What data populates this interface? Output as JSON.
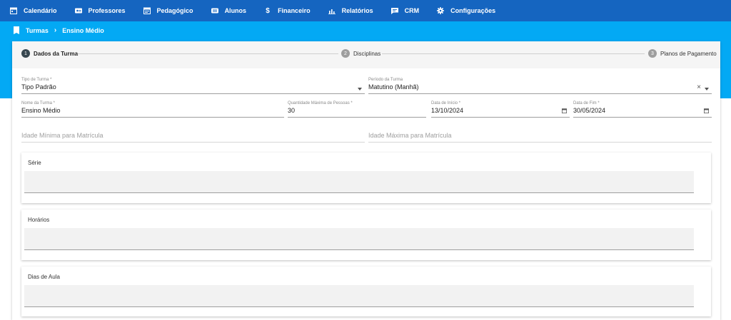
{
  "nav": {
    "items": [
      {
        "label": "Calendário",
        "icon": "calendar-icon"
      },
      {
        "label": "Professores",
        "icon": "id-card-icon"
      },
      {
        "label": "Pedagógico",
        "icon": "calendar-note-icon"
      },
      {
        "label": "Alunos",
        "icon": "students-icon"
      },
      {
        "label": "Financeiro",
        "icon": "dollar-icon"
      },
      {
        "label": "Relatórios",
        "icon": "chart-icon"
      },
      {
        "label": "CRM",
        "icon": "chat-icon"
      },
      {
        "label": "Configurações",
        "icon": "gear-icon"
      }
    ]
  },
  "breadcrumb": {
    "root": "Turmas",
    "current": "Ensino Médio"
  },
  "stepper": {
    "steps": [
      {
        "num": "1",
        "label": "Dados da Turma",
        "state": "active"
      },
      {
        "num": "2",
        "label": "Disciplinas",
        "state": "inactive"
      },
      {
        "num": "3",
        "label": "Planos de Pagamento",
        "state": "inactive"
      }
    ]
  },
  "form": {
    "tipo_turma": {
      "label": "Tipo de Turma *",
      "value": "Tipo Padrão"
    },
    "periodo_turma": {
      "label": "Período da Turma",
      "value": "Matutino (Manhã)",
      "clear": "×"
    },
    "nome_turma": {
      "label": "Nome da Turma *",
      "value": "Ensino Médio"
    },
    "qtd_max": {
      "label": "Quantidade Máxima de Pessoas *",
      "value": "30"
    },
    "data_inicio": {
      "label": "Data de Início *",
      "value": "13/10/2024"
    },
    "data_fim": {
      "label": "Data de Fim *",
      "value": "30/05/2024"
    },
    "idade_min": {
      "placeholder": "Idade Mínima para Matrícula"
    },
    "idade_max": {
      "placeholder": "Idade Máxima para Matrícula"
    }
  },
  "panels": {
    "serie": "Série",
    "horarios": "Horários",
    "dias_aula": "Dias de Aula"
  },
  "colors": {
    "nav_bg": "#1565c0",
    "band_bg": "#03a9f4",
    "step_active": "#37474f",
    "step_inactive": "#9e9e9e"
  }
}
